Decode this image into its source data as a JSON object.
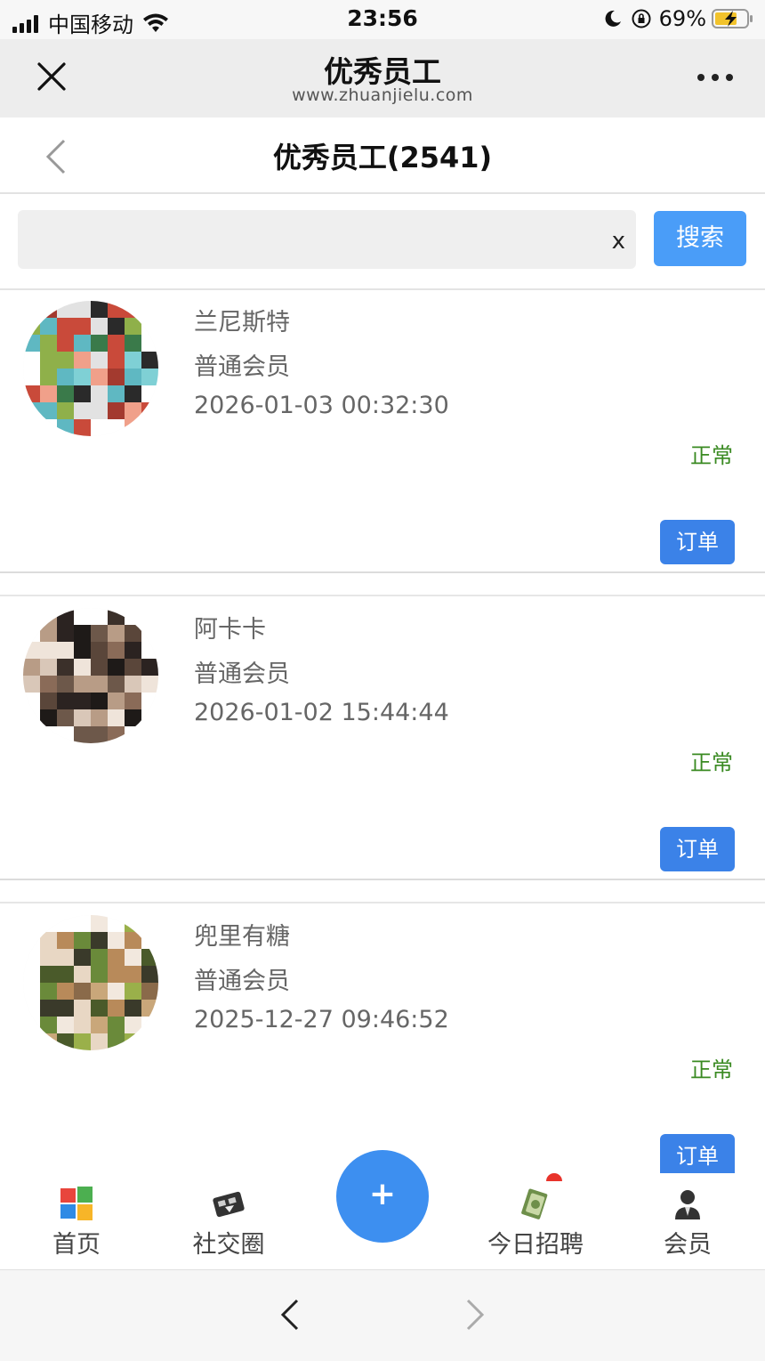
{
  "status_bar": {
    "carrier": "中国移动",
    "time": "23:56",
    "battery": "69%"
  },
  "wechat_header": {
    "title": "优秀员工",
    "url": "www.zhuanjielu.com"
  },
  "page": {
    "title": "优秀员工(2541)"
  },
  "search": {
    "value": "",
    "placeholder": "",
    "clear_label": "x",
    "button_label": "搜索"
  },
  "employees": [
    {
      "name": "兰尼斯特",
      "level": "普通会员",
      "date": "2026-01-03 00:32:30",
      "status": "正常",
      "order_label": "订单"
    },
    {
      "name": "阿卡卡",
      "level": "普通会员",
      "date": "2026-01-02 15:44:44",
      "status": "正常",
      "order_label": "订单"
    },
    {
      "name": "兜里有糖",
      "level": "普通会员",
      "date": "2025-12-27 09:46:52",
      "status": "正常",
      "order_label": "订单"
    }
  ],
  "bottom_nav": {
    "home": "首页",
    "social": "社交圈",
    "fab": "+",
    "jobs": "今日招聘",
    "member": "会员"
  },
  "colors": {
    "accent": "#4a9df8",
    "order_button": "#3b82e8",
    "status_ok": "#3a8a22",
    "fab": "#3d8ff0"
  }
}
